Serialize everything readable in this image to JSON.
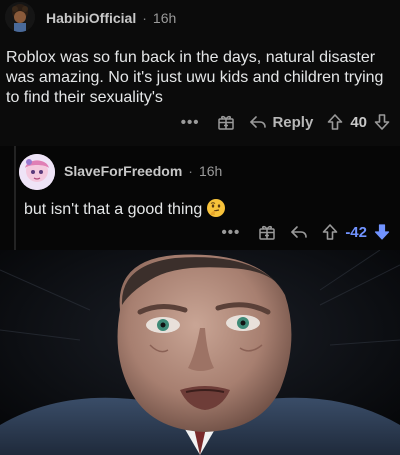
{
  "comments": [
    {
      "username": "HabibiOfficial",
      "separator": "·",
      "time": "16h",
      "body": "Roblox was so fun back in the days, natural disaster was amazing. No it's just uwu kids and children trying to find their sexuality's",
      "actions": {
        "more": "•••",
        "reply_label": "Reply",
        "score": "40"
      }
    },
    {
      "username": "SlaveForFreedom",
      "separator": "·",
      "time": "16h",
      "body": "but isn't that a good thing",
      "emoji": "thinking-face-icon",
      "actions": {
        "more": "•••",
        "score": "-42"
      }
    }
  ],
  "colors": {
    "downvote_active": "#7193ff",
    "background": "#000000"
  }
}
